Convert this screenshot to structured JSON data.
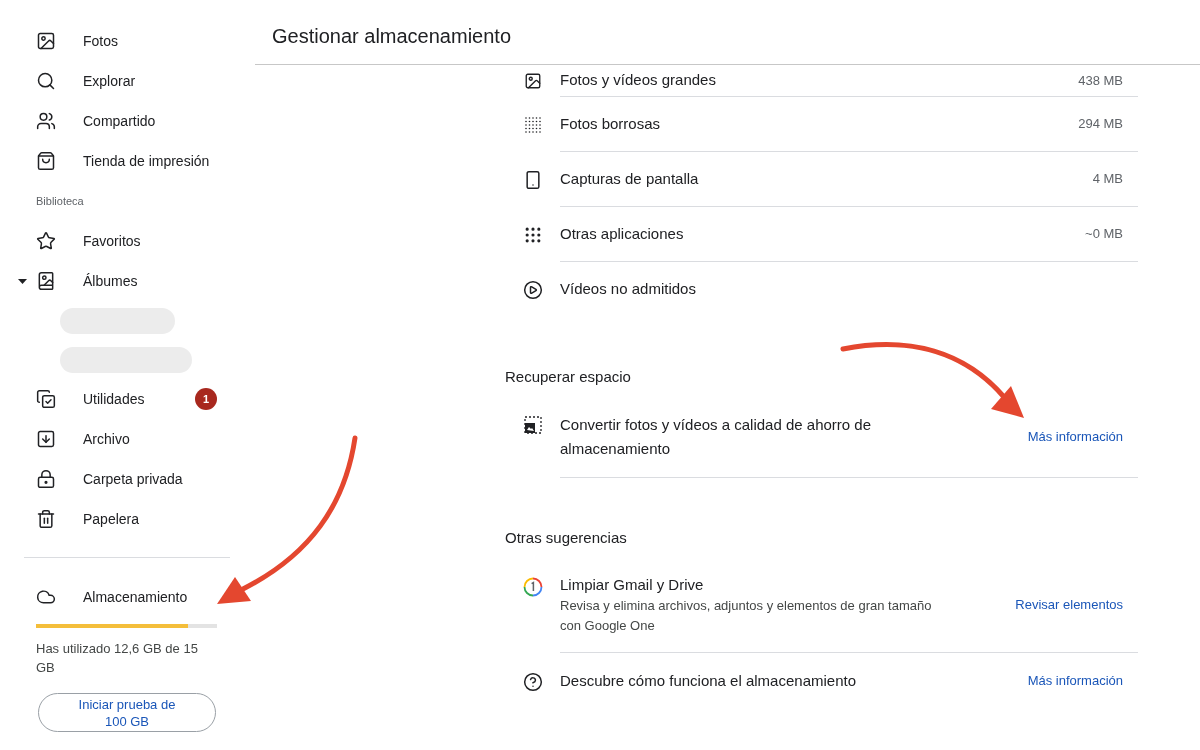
{
  "sidebar": {
    "primary": [
      {
        "label": "Fotos",
        "selected": false
      },
      {
        "label": "Explorar",
        "selected": false
      },
      {
        "label": "Compartido",
        "selected": false
      },
      {
        "label": "Tienda de impresión",
        "selected": false
      }
    ],
    "library_heading": "Biblioteca",
    "library": [
      {
        "label": "Favoritos",
        "selected": false
      },
      {
        "label": "Álbumes",
        "selected": false,
        "expanded": true,
        "children": [
          {
            "kind": "redacted"
          },
          {
            "kind": "redacted"
          }
        ]
      },
      {
        "label": "Utilidades",
        "selected": false,
        "badge": "1"
      },
      {
        "label": "Archivo",
        "selected": false
      },
      {
        "label": "Carpeta privada",
        "selected": false
      },
      {
        "label": "Papelera",
        "selected": false
      }
    ],
    "storage": {
      "label": "Almacenamiento",
      "selected": false,
      "level": 0.84,
      "usage": "Has utilizado 12,6 GB de 15 GB",
      "trial_button": "Iniciar prueba de 100 GB"
    }
  },
  "header": {
    "title": "Gestionar almacenamiento"
  },
  "categories": [
    {
      "label": "Fotos y vídeos grandes",
      "size": "438 MB"
    },
    {
      "label": "Fotos borrosas",
      "size": "294 MB"
    },
    {
      "label": "Capturas de pantalla",
      "size": "4 MB"
    },
    {
      "label": "Otras aplicaciones",
      "size": "~0 MB"
    },
    {
      "label": "Vídeos no admitidos"
    }
  ],
  "sections": [
    {
      "heading": "Recuperar espacio",
      "items": [
        {
          "title": "Convertir fotos y vídeos a calidad de ahorro de almacenamiento",
          "link": "Más información"
        }
      ]
    },
    {
      "heading": "Otras sugerencias",
      "items": [
        {
          "title": "Limpiar Gmail y Drive",
          "description": "Revisa y elimina archivos, adjuntos y elementos de gran tamaño con Google One",
          "link": "Revisar elementos"
        },
        {
          "title": "Descubre cómo funciona el almacenamiento",
          "link": "Más información"
        }
      ]
    }
  ],
  "annotations": [
    {
      "kind": "arrow"
    },
    {
      "kind": "arrow"
    }
  ]
}
